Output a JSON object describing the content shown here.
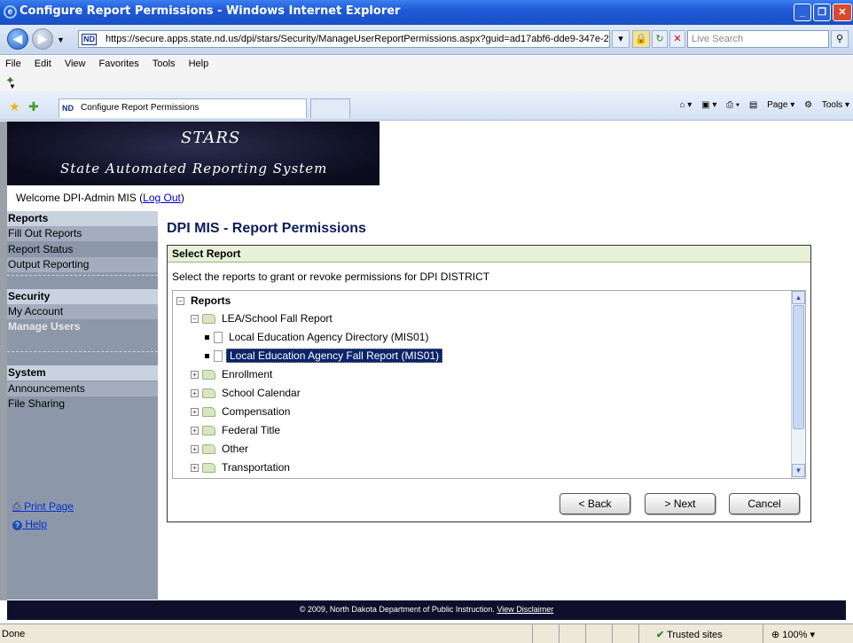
{
  "browser": {
    "title": "Configure Report Permissions - Windows Internet Explorer",
    "url": "https://secure.apps.state.nd.us/dpi/stars/Security/ManageUserReportPermissions.aspx?guid=ad17abf6-dde9-347e-2",
    "search_placeholder": "Live Search",
    "menu": [
      "File",
      "Edit",
      "View",
      "Favorites",
      "Tools",
      "Help"
    ],
    "tab_label": "Configure Report Permissions",
    "tab_logo": "ND",
    "command_bar": {
      "page": "Page",
      "tools": "Tools"
    },
    "status_text": "Done",
    "zone": "Trusted sites",
    "zoom": "100%"
  },
  "banner": {
    "title": "STARS",
    "subtitle": "State Automated Reporting System"
  },
  "welcome": {
    "text": "Welcome DPI-Admin MIS (",
    "logout": "Log Out",
    "close": ")"
  },
  "sidebar": {
    "reports_head": "Reports",
    "reports_items": [
      "Fill Out Reports",
      "Report Status",
      "Output Reporting"
    ],
    "security_head": "Security",
    "security_items": [
      "My Account",
      "Manage Users"
    ],
    "system_head": "System",
    "system_items": [
      "Announcements",
      "File Sharing"
    ],
    "print_page": "Print Page",
    "help": "Help"
  },
  "page": {
    "title": "DPI MIS - Report Permissions",
    "panel_header": "Select Report",
    "instruction": "Select the reports to grant or revoke permissions for DPI DISTRICT"
  },
  "tree": {
    "root": "Reports",
    "lea_folder": "LEA/School Fall Report",
    "lea_children": [
      "Local Education Agency Directory (MIS01)",
      "Local Education Agency Fall Report (MIS01)"
    ],
    "folders": [
      "Enrollment",
      "School Calendar",
      "Compensation",
      "Federal Title",
      "Other",
      "Transportation"
    ]
  },
  "buttons": {
    "back": "< Back",
    "next": "> Next",
    "cancel": "Cancel"
  },
  "footer": {
    "text": "© 2009, North Dakota Department of Public Instruction.",
    "link": "View Disclaimer"
  },
  "colors": {
    "banner_bg": "#0a0b1c",
    "sidebar_bg": "#8d97aa",
    "panel_header_bg": "#e8f0d7",
    "selection_bg": "#0a246a",
    "footer_bg": "#0f0f2b"
  }
}
